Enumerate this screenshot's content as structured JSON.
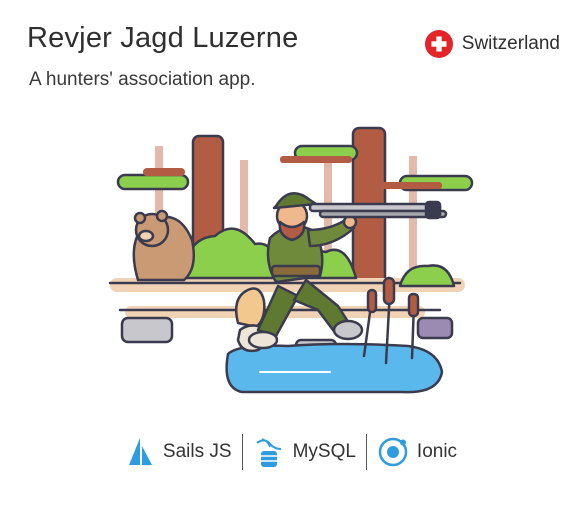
{
  "header": {
    "title": "Revjer Jagd Luzerne",
    "subtitle": "A hunters' association app.",
    "country": "Switzerland"
  },
  "illustration": {
    "icon": "hunter-illustration"
  },
  "tech_stack": [
    {
      "label": "Sails JS",
      "icon": "sails-js-icon"
    },
    {
      "label": "MySQL",
      "icon": "mysql-icon"
    },
    {
      "label": "Ionic",
      "icon": "ionic-icon"
    }
  ],
  "colors": {
    "flag_red": "#e3242b",
    "accent_blue": "#2f9be0",
    "tree_brown": "#b35c44",
    "leaf_green": "#8ccf4d",
    "water_blue": "#5ab8ec",
    "outline": "#3b3b4f"
  }
}
